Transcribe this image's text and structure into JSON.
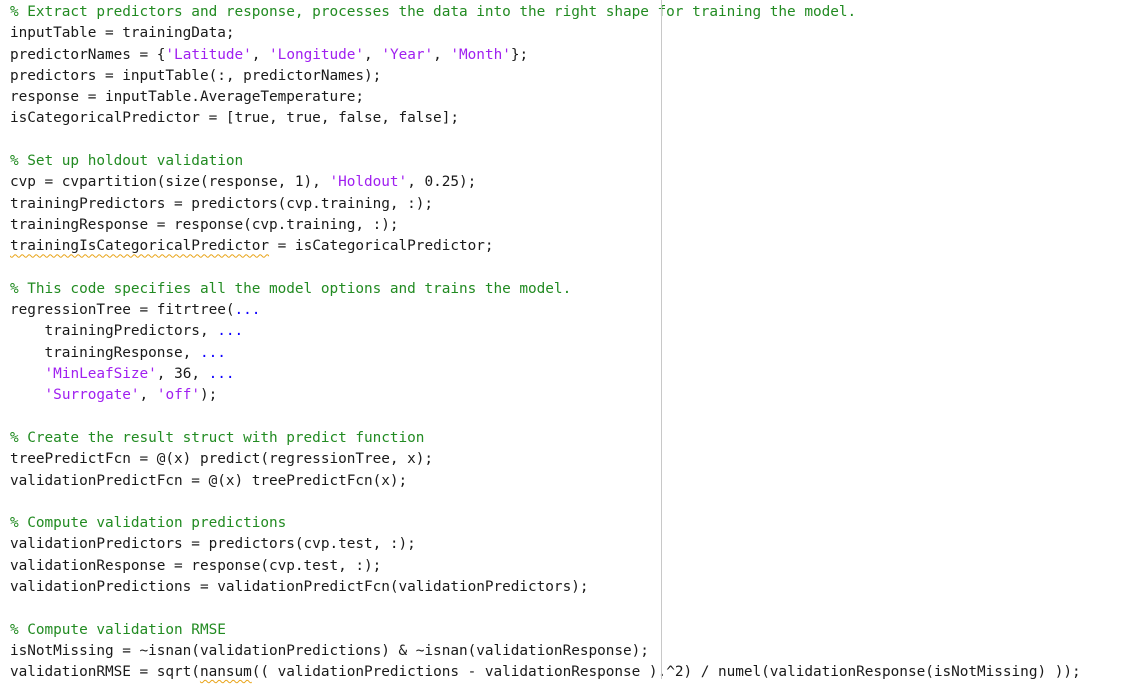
{
  "editor": {
    "lines": [
      [
        {
          "t": "% Extract predictors and response, processes the data into the right shape for training the model.",
          "c": "comment"
        }
      ],
      [
        {
          "t": "inputTable = trainingData;"
        }
      ],
      [
        {
          "t": "predictorNames = {"
        },
        {
          "t": "'Latitude'",
          "c": "string"
        },
        {
          "t": ", "
        },
        {
          "t": "'Longitude'",
          "c": "string"
        },
        {
          "t": ", "
        },
        {
          "t": "'Year'",
          "c": "string"
        },
        {
          "t": ", "
        },
        {
          "t": "'Month'",
          "c": "string"
        },
        {
          "t": "};"
        }
      ],
      [
        {
          "t": "predictors = inputTable(:, predictorNames);"
        }
      ],
      [
        {
          "t": "response = inputTable.AverageTemperature;"
        }
      ],
      [
        {
          "t": "isCategoricalPredictor = [true, true, false, false];"
        }
      ],
      [],
      [
        {
          "t": "% Set up holdout validation",
          "c": "comment"
        }
      ],
      [
        {
          "t": "cvp = cvpartition(size(response, 1), "
        },
        {
          "t": "'Holdout'",
          "c": "string"
        },
        {
          "t": ", 0.25);"
        }
      ],
      [
        {
          "t": "trainingPredictors = predictors(cvp.training, :);"
        }
      ],
      [
        {
          "t": "trainingResponse = response(cvp.training, :);"
        }
      ],
      [
        {
          "t": "trainingIsCategoricalPredictor",
          "c": "warning"
        },
        {
          "t": " = isCategoricalPredictor;"
        }
      ],
      [],
      [
        {
          "t": "% This code specifies all the model options and trains the model.",
          "c": "comment"
        }
      ],
      [
        {
          "t": "regressionTree = fitrtree("
        },
        {
          "t": "...",
          "c": "keyword"
        }
      ],
      [
        {
          "t": "    trainingPredictors, "
        },
        {
          "t": "...",
          "c": "keyword"
        }
      ],
      [
        {
          "t": "    trainingResponse, "
        },
        {
          "t": "...",
          "c": "keyword"
        }
      ],
      [
        {
          "t": "    "
        },
        {
          "t": "'MinLeafSize'",
          "c": "string"
        },
        {
          "t": ", 36, "
        },
        {
          "t": "...",
          "c": "keyword"
        }
      ],
      [
        {
          "t": "    "
        },
        {
          "t": "'Surrogate'",
          "c": "string"
        },
        {
          "t": ", "
        },
        {
          "t": "'off'",
          "c": "string"
        },
        {
          "t": ");"
        }
      ],
      [],
      [
        {
          "t": "% Create the result struct with predict function",
          "c": "comment"
        }
      ],
      [
        {
          "t": "treePredictFcn = @(x) predict(regressionTree, x);"
        }
      ],
      [
        {
          "t": "validationPredictFcn = @(x) treePredictFcn(x);"
        }
      ],
      [],
      [
        {
          "t": "% Compute validation predictions",
          "c": "comment"
        }
      ],
      [
        {
          "t": "validationPredictors = predictors(cvp.test, :);"
        }
      ],
      [
        {
          "t": "validationResponse = response(cvp.test, :);"
        }
      ],
      [
        {
          "t": "validationPredictions = validationPredictFcn(validationPredictors);"
        }
      ],
      [],
      [
        {
          "t": "% Compute validation RMSE",
          "c": "comment"
        }
      ],
      [
        {
          "t": "isNotMissing = ~isnan(validationPredictions) & ~isnan(validationResponse);"
        }
      ],
      [
        {
          "t": "validationRMSE = sqrt("
        },
        {
          "t": "nansum",
          "c": "warning"
        },
        {
          "t": "(( validationPredictions - validationResponse ).^2) / numel(validationResponse(isNotMissing) ));"
        }
      ]
    ]
  },
  "colors": {
    "comment": "#228b22",
    "string": "#a020f0",
    "keyword": "#0e00ff",
    "text": "#1a1a1a",
    "warning_underline": "#e8a317",
    "right_margin_line": "#c8c8c8"
  }
}
